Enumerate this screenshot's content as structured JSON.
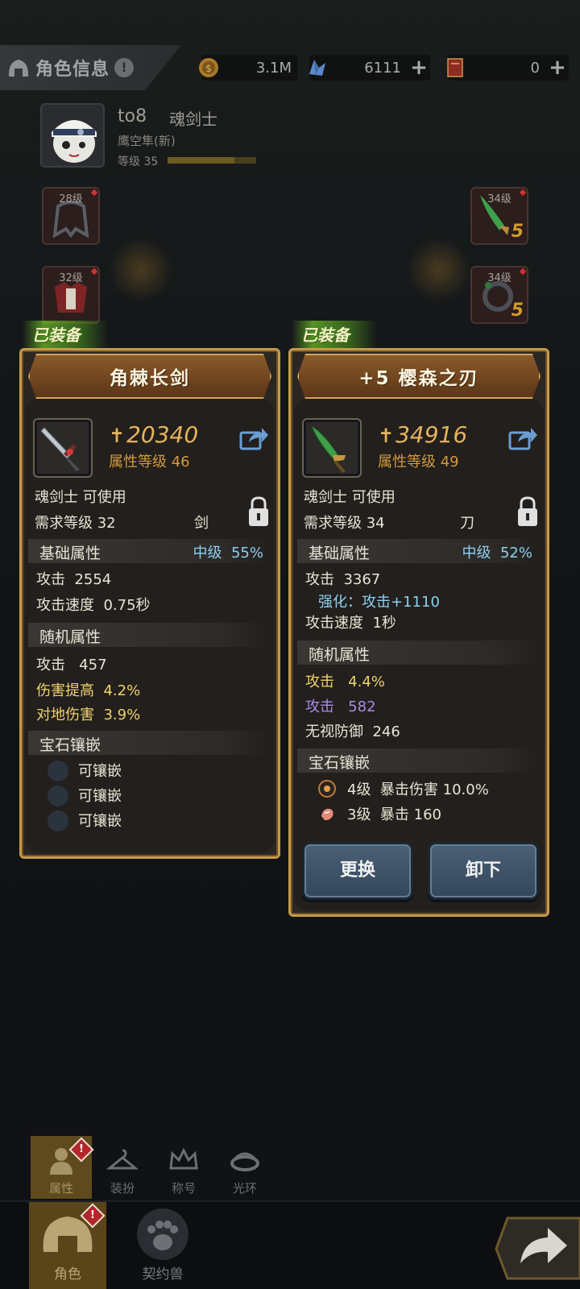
{
  "topbar": {
    "title": "角色信息",
    "resources": [
      {
        "name": "gold",
        "icon": "gold-coin-icon",
        "value": "3.1M",
        "has_plus": false
      },
      {
        "name": "crystal",
        "icon": "blue-crystal-icon",
        "value": "6111",
        "has_plus": true
      },
      {
        "name": "scroll",
        "icon": "red-book-icon",
        "value": "0",
        "has_plus": true
      }
    ]
  },
  "character": {
    "name": "to8",
    "class": "魂剑士",
    "guild": "鹰空隼(新)",
    "level_label": "等级 35",
    "level_progress": 0.75
  },
  "slots": {
    "left_top": "28级",
    "left_mid": "32级",
    "right_top": "34级",
    "right_mid": "34级",
    "enhance_top": "5",
    "enhance_mid": "5"
  },
  "left_card": {
    "equipped_tag": "已装备",
    "name": "角棘长剑",
    "power": "20340",
    "attr_level": "属性等级 46",
    "usable": "魂剑士 可使用",
    "req_level": "需求等级 32",
    "weapon_type": "剑",
    "base_title": "基础属性",
    "base_grade": "中级",
    "base_percent": "55%",
    "base_stats": [
      {
        "label": "攻击",
        "value": "2554"
      },
      {
        "label": "攻击速度",
        "value": "0.75秒"
      }
    ],
    "random_title": "随机属性",
    "random_stats": [
      {
        "label": "攻击",
        "value": "457"
      },
      {
        "label": "伤害提高",
        "value": "4.2%"
      },
      {
        "label": "对地伤害",
        "value": "3.9%"
      }
    ],
    "gem_title": "宝石镶嵌",
    "gems": [
      "可镶嵌",
      "可镶嵌",
      "可镶嵌"
    ]
  },
  "right_card": {
    "equipped_tag": "已装备",
    "name": "+5 樱森之刃",
    "power": "34916",
    "attr_level": "属性等级 49",
    "usable": "魂剑士 可使用",
    "req_level": "需求等级 34",
    "weapon_type": "刀",
    "base_title": "基础属性",
    "base_grade": "中级",
    "base_percent": "52%",
    "base_attack_label": "攻击",
    "base_attack_value": "3367",
    "enhance_line": "强化：攻击+1110",
    "speed_label": "攻击速度",
    "speed_value": "1秒",
    "random_title": "随机属性",
    "random_stats": [
      {
        "label": "攻击",
        "value": "4.4%"
      },
      {
        "label": "攻击",
        "value": "582"
      },
      {
        "label": "无视防御",
        "value": "246"
      }
    ],
    "gem_title": "宝石镶嵌",
    "gems": [
      {
        "level": "4级",
        "effect": "暴击伤害 10.0%"
      },
      {
        "level": "3级",
        "effect": "暴击 160"
      }
    ],
    "btn_replace": "更换",
    "btn_unequip": "卸下"
  },
  "subtabs": [
    "属性",
    "装扮",
    "称号",
    "光环"
  ],
  "maintabs": [
    "角色",
    "契约兽"
  ],
  "colors": {
    "gold_text": "#e4b35c",
    "blue_text": "#8dd0f0",
    "purple_text": "#a98be8",
    "yellow_text": "#f1d36b"
  }
}
